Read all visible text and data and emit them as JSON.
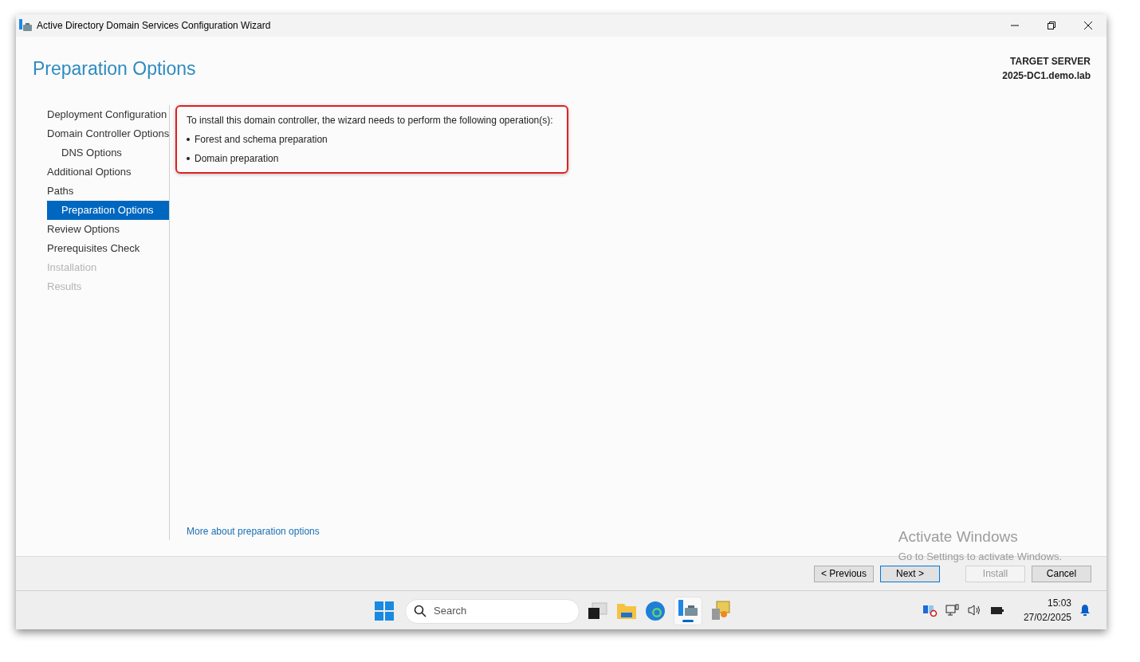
{
  "window": {
    "title": "Active Directory Domain Services Configuration Wizard"
  },
  "page_title": "Preparation Options",
  "target_server": {
    "label": "TARGET SERVER",
    "name": "2025-DC1.demo.lab"
  },
  "sidebar": {
    "items": [
      {
        "label": "Deployment Configuration",
        "selected": false,
        "disabled": false
      },
      {
        "label": "Domain Controller Options",
        "selected": false,
        "disabled": false,
        "children": [
          {
            "label": "DNS Options",
            "selected": false,
            "disabled": false
          }
        ]
      },
      {
        "label": "Additional Options",
        "selected": false,
        "disabled": false
      },
      {
        "label": "Paths",
        "selected": false,
        "disabled": false,
        "children": [
          {
            "label": "Preparation Options",
            "selected": true,
            "disabled": false
          }
        ]
      },
      {
        "label": "Review Options",
        "selected": false,
        "disabled": false
      },
      {
        "label": "Prerequisites Check",
        "selected": false,
        "disabled": false
      },
      {
        "label": "Installation",
        "selected": false,
        "disabled": true
      },
      {
        "label": "Results",
        "selected": false,
        "disabled": true
      }
    ]
  },
  "content": {
    "intro": "To install this domain controller, the wizard needs to perform the following operation(s):",
    "operations": [
      "Forest and schema preparation",
      "Domain preparation"
    ],
    "link": "More about preparation options"
  },
  "activation_notice": {
    "title": "Activate Windows",
    "subtitle": "Go to Settings to activate Windows."
  },
  "buttons": [
    {
      "label": "< Previous",
      "disabled": false,
      "focused": false
    },
    {
      "label": "Next >",
      "disabled": false,
      "focused": true
    },
    {
      "label": "Install",
      "disabled": true,
      "focused": false
    },
    {
      "label": "Cancel",
      "disabled": false,
      "focused": false
    }
  ],
  "taskbar": {
    "search_placeholder": "Search",
    "time": "15:03",
    "date": "27/02/2025"
  }
}
